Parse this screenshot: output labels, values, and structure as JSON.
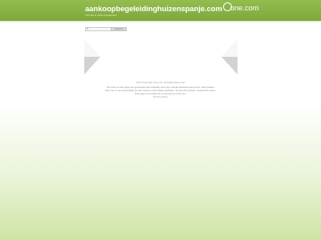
{
  "header": {
    "domain": "aankoopbegeleidinghuizenspanje.com",
    "brand": "one.com",
    "tagline": "This site is under construction"
  },
  "search": {
    "placeholder": "",
    "button_label": "Search"
  },
  "footer": {
    "copyright": "2013 Copyright One.com All Rights Reserved",
    "disclaimer": "The links on this page are generated automatically and may include advertisements from third parties. One.com is not responsible for the content of the linked websites. To buy this domain, contact the owner. This page is provided as a courtesy by One.com.",
    "privacy": "Privacy Policy"
  },
  "colors": {
    "header_green": "#8ab446",
    "bottom_green": "#cfe4a4"
  },
  "icons": [
    "arrow-left-icon",
    "arrow-right-icon",
    "one-com-logo-icon"
  ]
}
